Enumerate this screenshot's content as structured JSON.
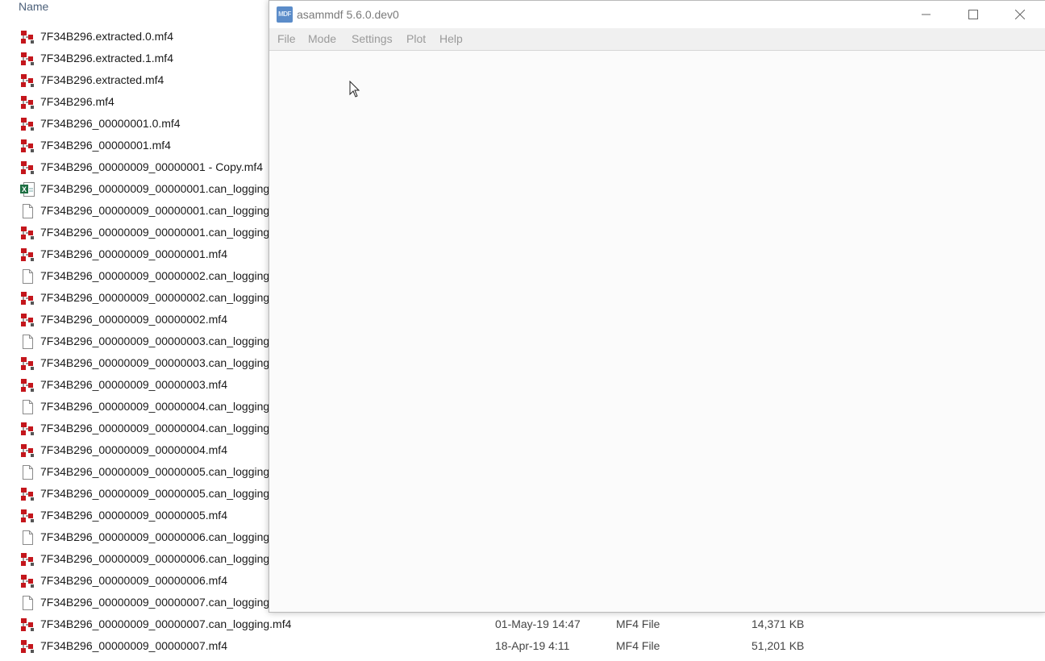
{
  "explorer": {
    "column_name": "Name",
    "files": [
      {
        "name": "7F34B296.extracted.0.mf4",
        "icon": "mdf-file-icon"
      },
      {
        "name": "7F34B296.extracted.1.mf4",
        "icon": "mdf-file-icon"
      },
      {
        "name": "7F34B296.extracted.mf4",
        "icon": "mdf-file-icon"
      },
      {
        "name": "7F34B296.mf4",
        "icon": "mdf-file-icon"
      },
      {
        "name": "7F34B296_00000001.0.mf4",
        "icon": "mdf-file-icon"
      },
      {
        "name": "7F34B296_00000001.mf4",
        "icon": "mdf-file-icon"
      },
      {
        "name": "7F34B296_00000009_00000001 - Copy.mf4",
        "icon": "mdf-file-icon"
      },
      {
        "name": "7F34B296_00000009_00000001.can_logging",
        "icon": "excel-file-icon"
      },
      {
        "name": "7F34B296_00000009_00000001.can_logging",
        "icon": "blank-file-icon"
      },
      {
        "name": "7F34B296_00000009_00000001.can_logging",
        "icon": "mdf-file-icon"
      },
      {
        "name": "7F34B296_00000009_00000001.mf4",
        "icon": "mdf-file-icon"
      },
      {
        "name": "7F34B296_00000009_00000002.can_logging",
        "icon": "blank-file-icon"
      },
      {
        "name": "7F34B296_00000009_00000002.can_logging",
        "icon": "mdf-file-icon"
      },
      {
        "name": "7F34B296_00000009_00000002.mf4",
        "icon": "mdf-file-icon"
      },
      {
        "name": "7F34B296_00000009_00000003.can_logging",
        "icon": "blank-file-icon"
      },
      {
        "name": "7F34B296_00000009_00000003.can_logging",
        "icon": "mdf-file-icon"
      },
      {
        "name": "7F34B296_00000009_00000003.mf4",
        "icon": "mdf-file-icon"
      },
      {
        "name": "7F34B296_00000009_00000004.can_logging",
        "icon": "blank-file-icon"
      },
      {
        "name": "7F34B296_00000009_00000004.can_logging",
        "icon": "mdf-file-icon"
      },
      {
        "name": "7F34B296_00000009_00000004.mf4",
        "icon": "mdf-file-icon"
      },
      {
        "name": "7F34B296_00000009_00000005.can_logging",
        "icon": "blank-file-icon"
      },
      {
        "name": "7F34B296_00000009_00000005.can_logging",
        "icon": "mdf-file-icon"
      },
      {
        "name": "7F34B296_00000009_00000005.mf4",
        "icon": "mdf-file-icon"
      },
      {
        "name": "7F34B296_00000009_00000006.can_logging",
        "icon": "blank-file-icon"
      },
      {
        "name": "7F34B296_00000009_00000006.can_logging",
        "icon": "mdf-file-icon"
      },
      {
        "name": "7F34B296_00000009_00000006.mf4",
        "icon": "mdf-file-icon"
      },
      {
        "name": "7F34B296_00000009_00000007.can_logging",
        "icon": "blank-file-icon"
      },
      {
        "name": "7F34B296_00000009_00000007.can_logging.mf4",
        "icon": "mdf-file-icon",
        "date": "01-May-19 14:47",
        "type": "MF4 File",
        "size": "14,371 KB"
      },
      {
        "name": "7F34B296_00000009_00000007.mf4",
        "icon": "mdf-file-icon",
        "date": "18-Apr-19 4:11",
        "type": "MF4 File",
        "size": "51,201 KB"
      }
    ]
  },
  "app": {
    "title": "asammdf 5.6.0.dev0",
    "icon_text": "MDF",
    "menu": [
      "File",
      "Mode",
      "Settings",
      "Plot",
      "Help"
    ]
  },
  "colors": {
    "mdf_icon_red": "#c4161c",
    "title_text": "#7a7a7a",
    "menu_text": "#9a9a9a"
  }
}
